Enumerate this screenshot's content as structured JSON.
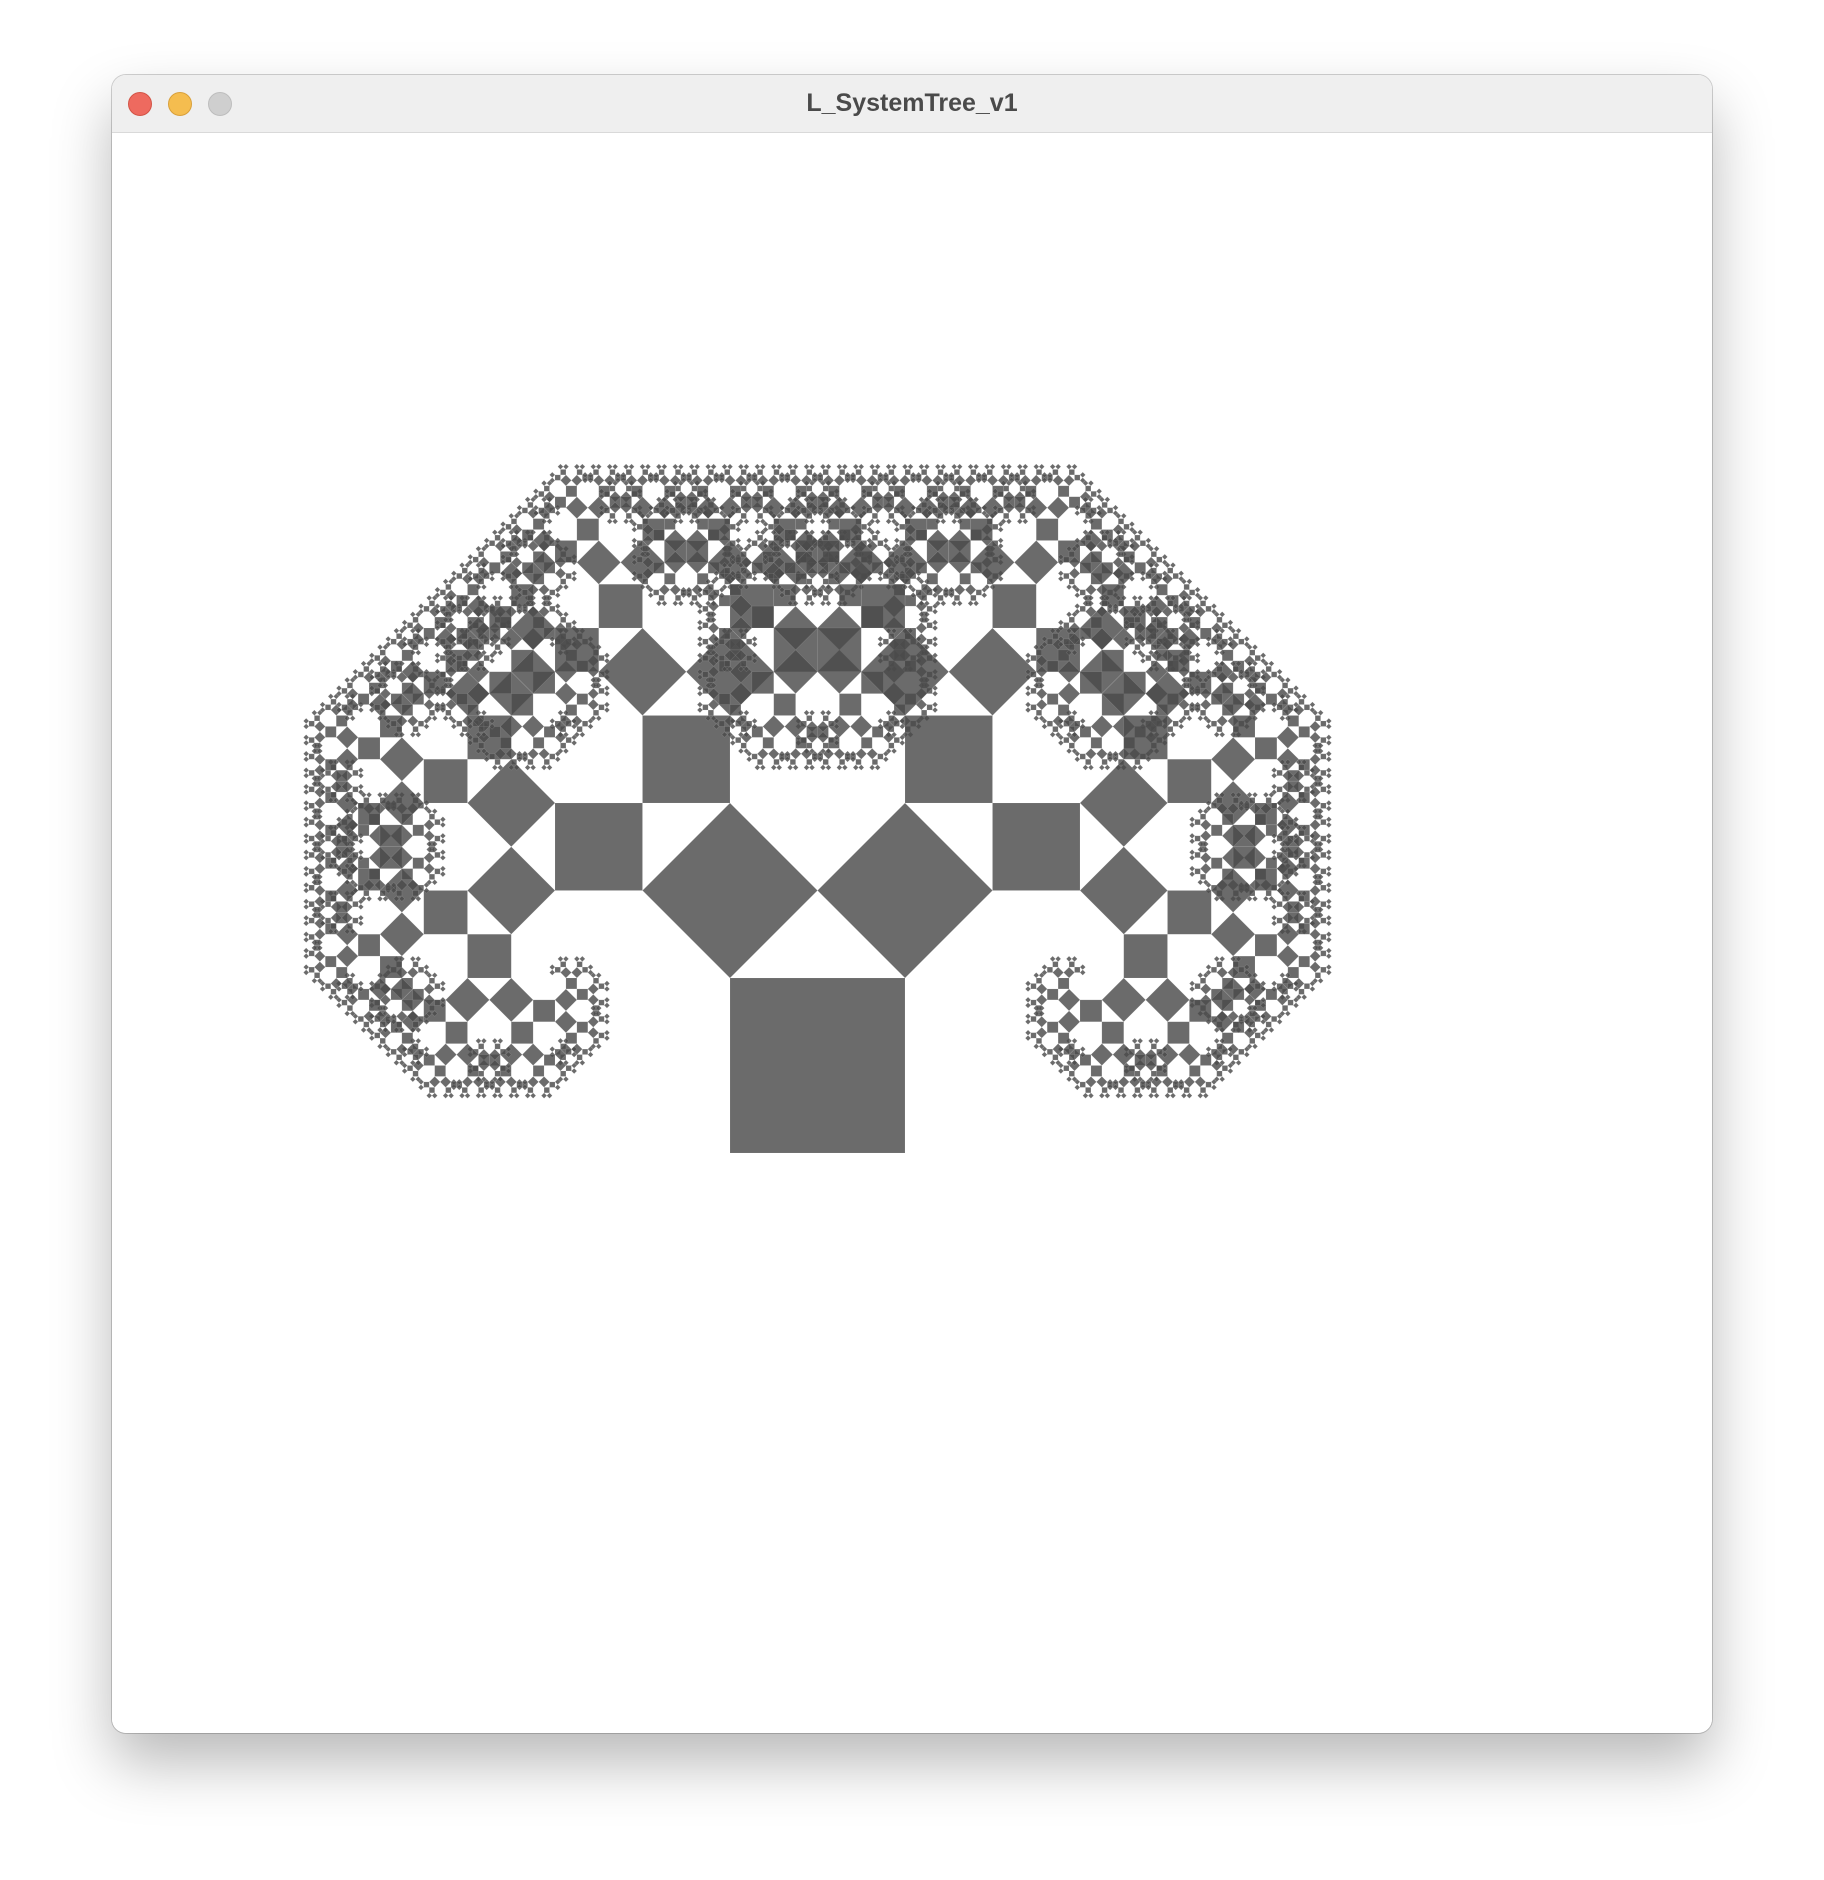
{
  "window": {
    "title": "L_SystemTree_v1"
  },
  "titlebar": {
    "buttons": [
      {
        "name": "close",
        "icon": "close-icon",
        "color": "#ee6a5f"
      },
      {
        "name": "minimize",
        "icon": "minimize-icon",
        "color": "#f5bd4f"
      },
      {
        "name": "zoom",
        "icon": "zoom-icon",
        "color": "#cfcfcf"
      }
    ]
  },
  "sketch": {
    "kind": "pythagoras-tree",
    "fill_color": "#4a4a4a",
    "fill_opacity": 0.82,
    "background": "#ffffff",
    "recursion_depth": 11,
    "branch_angle_deg": 45
  }
}
